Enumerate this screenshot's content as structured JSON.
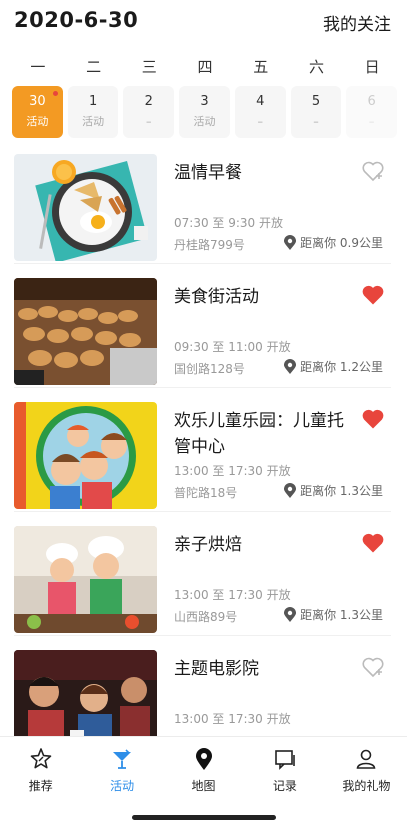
{
  "header": {
    "date": "2020-6-30",
    "follow_label": "我的关注"
  },
  "weekdays": [
    "一",
    "二",
    "三",
    "四",
    "五",
    "六",
    "日"
  ],
  "days": [
    {
      "num": "30",
      "sub": "活动"
    },
    {
      "num": "1",
      "sub": "活动"
    },
    {
      "num": "2",
      "sub": "–"
    },
    {
      "num": "3",
      "sub": "活动"
    },
    {
      "num": "4",
      "sub": "–"
    },
    {
      "num": "5",
      "sub": "–"
    },
    {
      "num": "6",
      "sub": "–"
    }
  ],
  "activities": [
    {
      "title": "温情早餐",
      "time": "07:30 至 9:30 开放",
      "address": "丹桂路799号",
      "distance": "距离你 0.9公里",
      "favorited": false
    },
    {
      "title": "美食街活动",
      "time": "09:30 至 11:00 开放",
      "address": "国创路128号",
      "distance": "距离你 1.2公里",
      "favorited": true
    },
    {
      "title": "欢乐儿童乐园：儿童托管中心",
      "time": "13:00 至 17:30 开放",
      "address": "普陀路18号",
      "distance": "距离你 1.3公里",
      "favorited": true
    },
    {
      "title": "亲子烘焙",
      "time": "13:00 至 17:30 开放",
      "address": "山西路89号",
      "distance": "距离你 1.3公里",
      "favorited": true
    },
    {
      "title": "主题电影院",
      "time": "13:00 至 17:30 开放",
      "address": "",
      "distance": "",
      "favorited": false
    }
  ],
  "tabbar": [
    {
      "label": "推荐",
      "icon": "star-badge-icon"
    },
    {
      "label": "活动",
      "icon": "cocktail-icon"
    },
    {
      "label": "地图",
      "icon": "map-pin-icon"
    },
    {
      "label": "记录",
      "icon": "chat-record-icon"
    },
    {
      "label": "我的礼物",
      "icon": "user-icon"
    }
  ],
  "colors": {
    "accent": "#f39a23",
    "heart": "#e8453c",
    "tab_active": "#2e8ee8"
  }
}
